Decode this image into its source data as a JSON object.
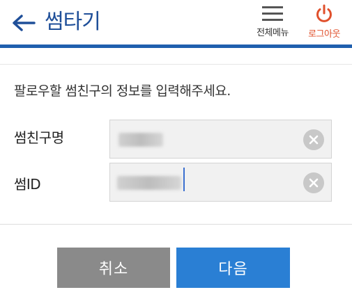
{
  "header": {
    "title": "썸타기",
    "menu_label": "전체메뉴",
    "logout_label": "로그아웃",
    "back_icon": "arrow-left-icon",
    "menu_icon": "hamburger-icon",
    "logout_icon": "power-icon"
  },
  "form": {
    "instruction": "팔로우할 썸친구의 정보를 입력해주세요.",
    "fields": [
      {
        "label": "썸친구명",
        "value": ""
      },
      {
        "label": "썸ID",
        "value": ""
      }
    ]
  },
  "actions": {
    "cancel_label": "취소",
    "next_label": "다음"
  },
  "colors": {
    "brand": "#1f4f99",
    "accent_bar": "#1f5fae",
    "logout": "#e0502c",
    "cancel": "#8a8a8a",
    "next": "#2a7fd4"
  }
}
